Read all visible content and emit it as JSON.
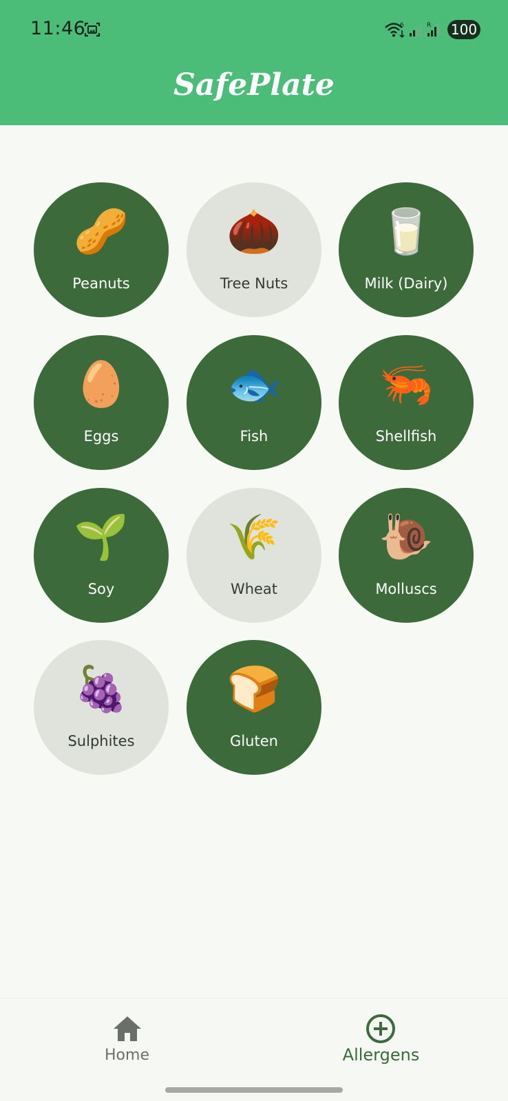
{
  "status_bar": {
    "time": "11:46",
    "battery": "100"
  },
  "app": {
    "title": "SafePlate"
  },
  "allergens": [
    {
      "label": "Peanuts",
      "emoji": "🥜",
      "selected": true
    },
    {
      "label": "Tree Nuts",
      "emoji": "🌰",
      "selected": false
    },
    {
      "label": "Milk (Dairy)",
      "emoji": "🥛",
      "selected": true
    },
    {
      "label": "Eggs",
      "emoji": "🥚",
      "selected": true
    },
    {
      "label": "Fish",
      "emoji": "🐟",
      "selected": true
    },
    {
      "label": "Shellfish",
      "emoji": "🦐",
      "selected": true
    },
    {
      "label": "Soy",
      "emoji": "🌱",
      "selected": true
    },
    {
      "label": "Wheat",
      "emoji": "🌾",
      "selected": false
    },
    {
      "label": "Molluscs",
      "emoji": "🐌",
      "selected": true
    },
    {
      "label": "Sulphites",
      "emoji": "🍇",
      "selected": false
    },
    {
      "label": "Gluten",
      "emoji": "🍞",
      "selected": true
    }
  ],
  "bottom_nav": {
    "home_label": "Home",
    "home_icon": "home-icon",
    "allergens_label": "Allergens",
    "allergens_icon": "add-circle-icon",
    "active": "Allergens"
  },
  "colors": {
    "header": "#4BBD78",
    "selected_tile": "#3C6A3B",
    "unselected_tile": "#E0E3DC",
    "background": "#F7F9F4"
  }
}
